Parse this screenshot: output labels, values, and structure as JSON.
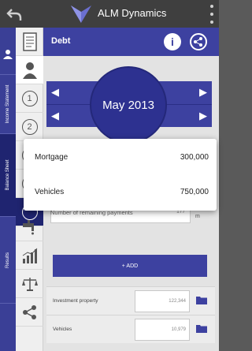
{
  "app": {
    "title": "ALM Dynamics"
  },
  "rail": {
    "sections": [
      "Income Statement",
      "Balance Sheet",
      "Results"
    ]
  },
  "icon_column": {
    "numbers": [
      "1",
      "2"
    ]
  },
  "panel": {
    "title": "Debt"
  },
  "date": {
    "label": "May 2013"
  },
  "remaining_payments": {
    "label": "Number of remaining payments",
    "value": "177",
    "unit": "m"
  },
  "add_button": {
    "label": "+ ADD"
  },
  "assets": [
    {
      "name": "Investment property",
      "value": "122,344"
    },
    {
      "name": "Vehicles",
      "value": "10,979"
    }
  ],
  "dropdown": {
    "options": [
      {
        "label": "Mortgage",
        "value": "300,000"
      },
      {
        "label": "Vehicles",
        "value": "750,000"
      }
    ]
  },
  "colors": {
    "primary": "#3d41a0",
    "appbar": "#3f3f3f",
    "rail": "#3a3f96"
  },
  "icons": [
    "back-icon",
    "logo-icon",
    "more-vertical-icon",
    "person-icon",
    "document-icon",
    "user-icon",
    "faucet-icon",
    "bar-chart-icon",
    "scale-icon",
    "share-icon",
    "info-icon",
    "arrow-left-icon",
    "arrow-right-icon",
    "folder-icon"
  ]
}
